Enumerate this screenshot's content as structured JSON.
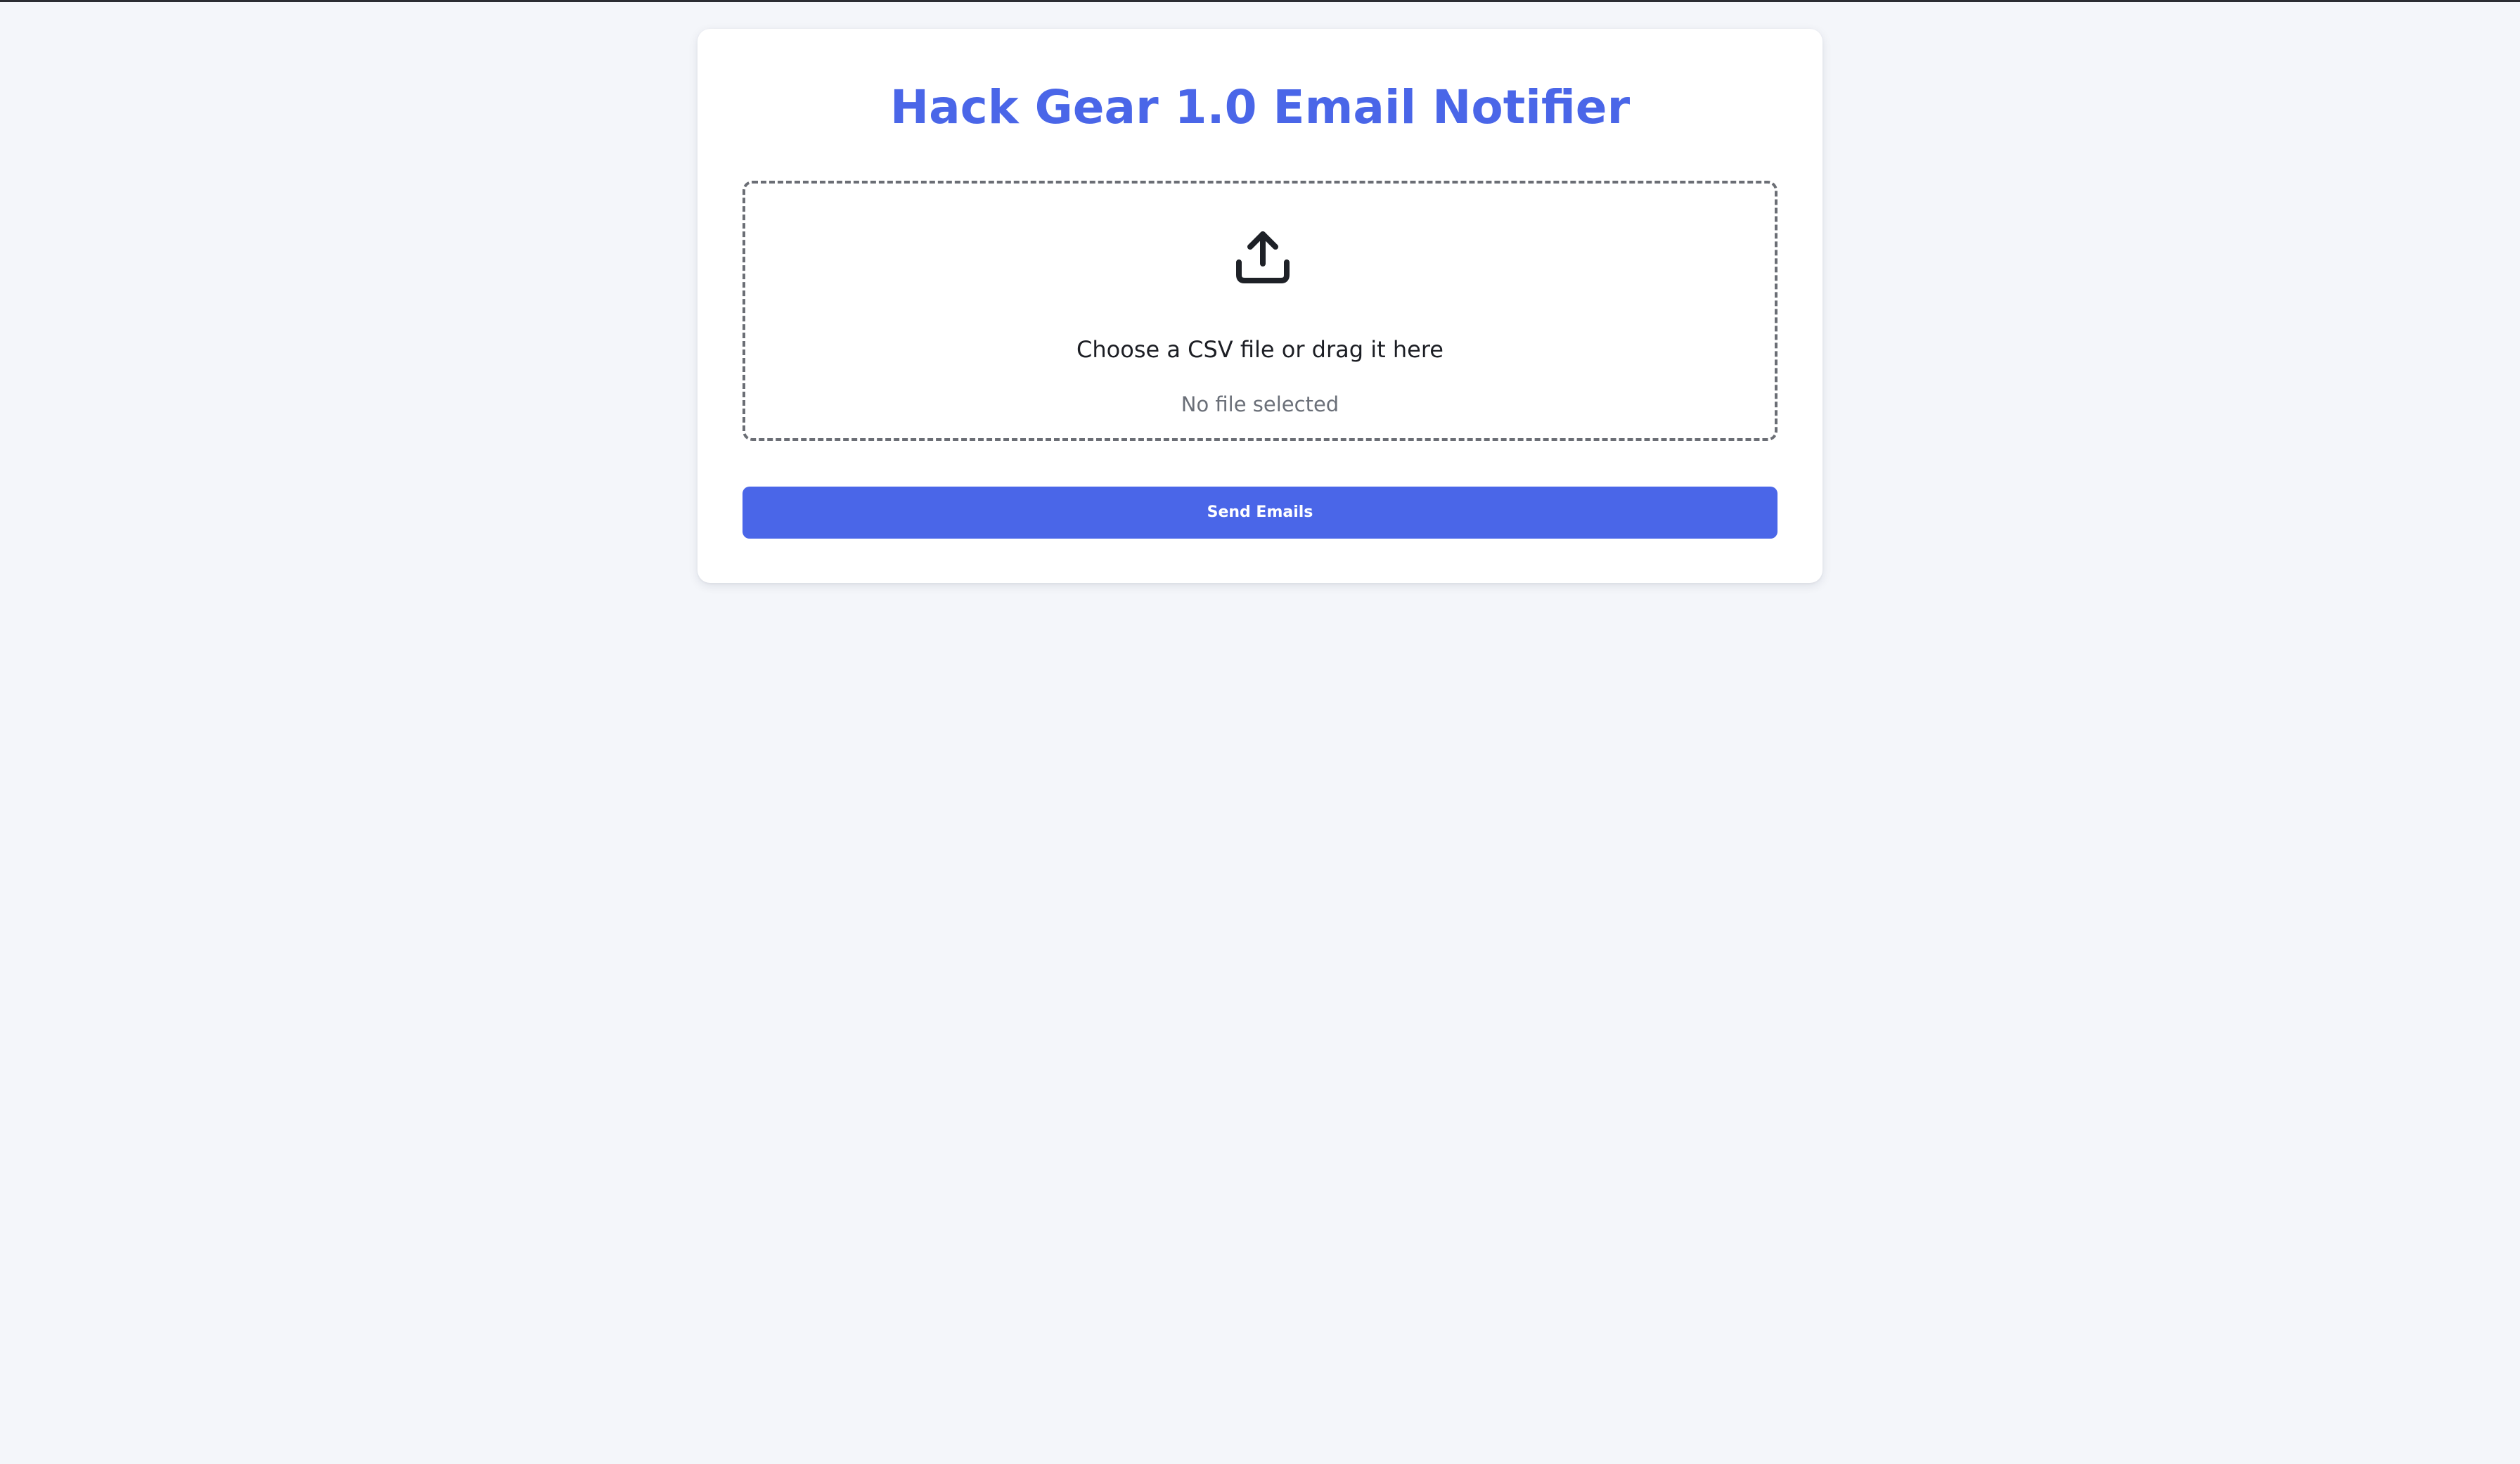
{
  "page": {
    "title": "Hack Gear 1.0 Email Notifier",
    "accent_color": "#4a66e8",
    "background_color": "#f4f6fa"
  },
  "upload": {
    "icon": "upload-icon",
    "label": "Choose a CSV file or drag it here",
    "status": "No file selected"
  },
  "actions": {
    "send_label": "Send Emails"
  }
}
